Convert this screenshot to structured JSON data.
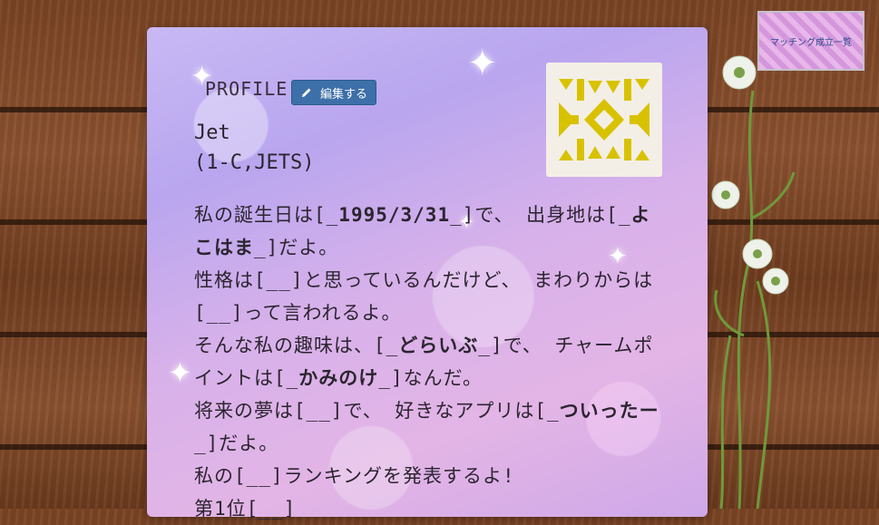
{
  "profile": {
    "label": "PROFILE",
    "edit_button": "編集する",
    "name": "Jet",
    "group": "(1-C,JETS)"
  },
  "matching_link": "マッチング成立一覧",
  "lines": [
    [
      "私の誕生日は[_",
      "1995/3/31",
      "_]で、 出身地は[_",
      "よこはま",
      "_]だよ。"
    ],
    [
      "性格は[__]と思っているんだけど、 まわりからは[__]って言われるよ。"
    ],
    [
      "そんな私の趣味は、[_",
      "どらいぶ",
      "_]で、 チャームポイントは[_",
      "かみのけ",
      "_]なんだ。"
    ],
    [
      "将来の夢は[__]で、 好きなアプリは[_",
      "ついったー",
      "_]だよ。"
    ],
    [
      "私の[__]ランキングを発表するよ!"
    ],
    [
      "第1位[__]"
    ]
  ],
  "colors": {
    "edit_button_bg": "#3d6fa8",
    "avatar_pattern": "#d8c200",
    "text": "#2c2530"
  },
  "icons": {
    "edit": "pencil-icon",
    "avatar": "identicon"
  }
}
